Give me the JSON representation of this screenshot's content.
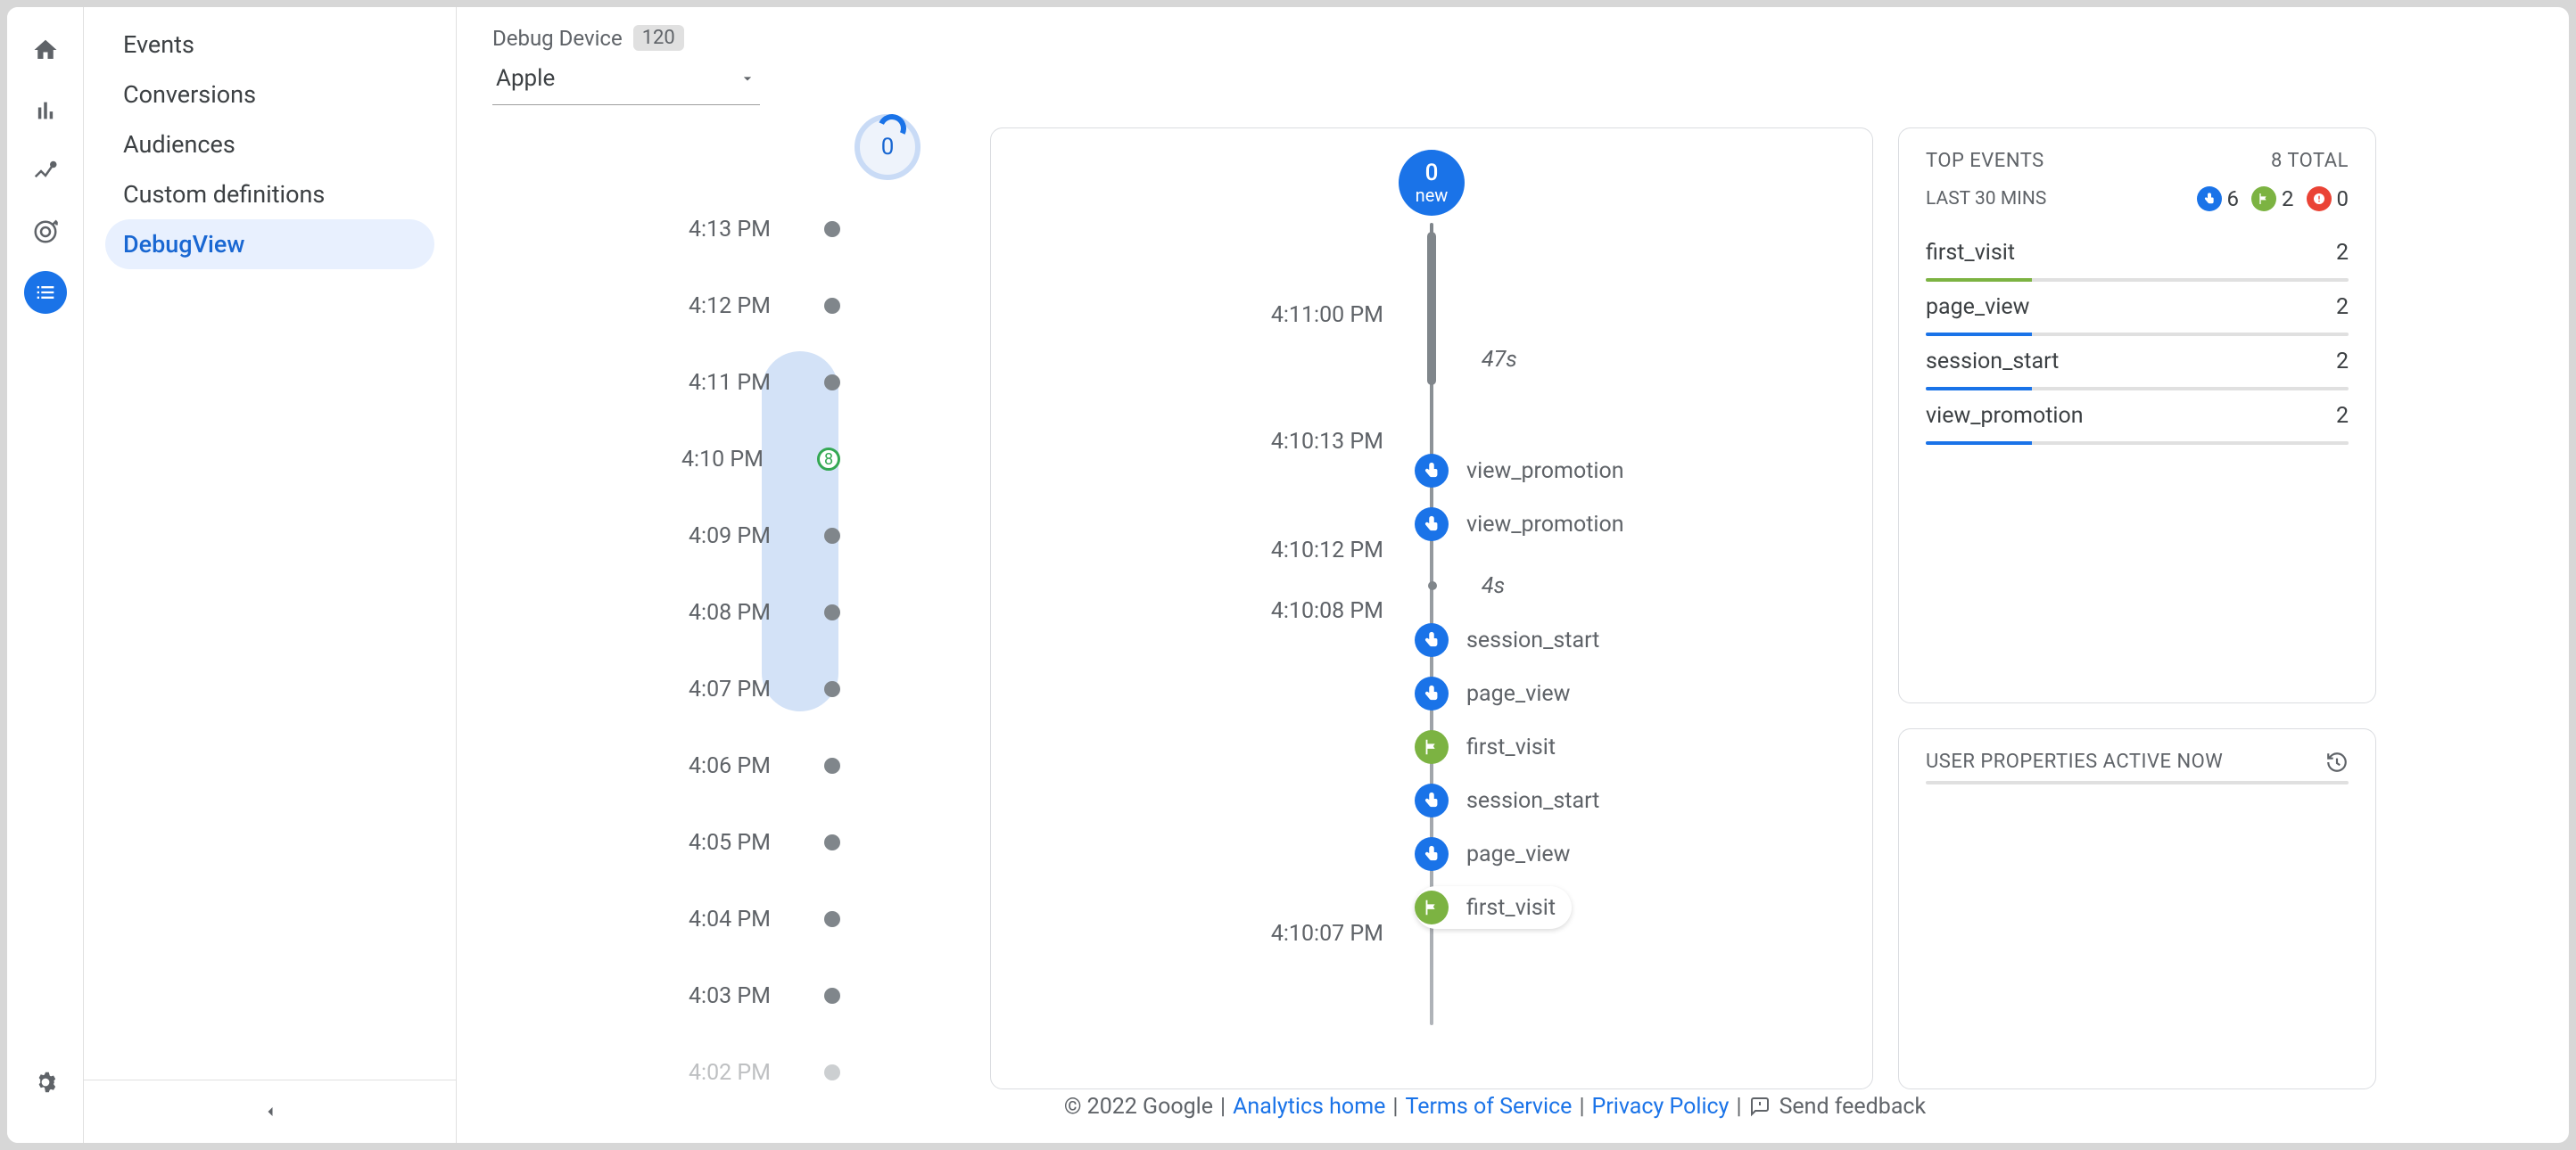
{
  "sidenav": {
    "items": [
      {
        "label": "Events"
      },
      {
        "label": "Conversions"
      },
      {
        "label": "Audiences"
      },
      {
        "label": "Custom definitions"
      },
      {
        "label": "DebugView"
      }
    ]
  },
  "header": {
    "debug_label": "Debug Device",
    "device_count": "120",
    "selected_device": "Apple"
  },
  "minute_timeline": {
    "zero": "0",
    "active_count": "8",
    "rows": [
      {
        "t": "4:13 PM"
      },
      {
        "t": "4:12 PM"
      },
      {
        "t": "4:11 PM"
      },
      {
        "t": "4:10 PM",
        "active": true
      },
      {
        "t": "4:09 PM"
      },
      {
        "t": "4:08 PM"
      },
      {
        "t": "4:07 PM"
      },
      {
        "t": "4:06 PM"
      },
      {
        "t": "4:05 PM"
      },
      {
        "t": "4:04 PM"
      },
      {
        "t": "4:03 PM"
      },
      {
        "t": "4:02 PM"
      }
    ]
  },
  "stream": {
    "new_count": "0",
    "new_label": "new",
    "timestamps": {
      "t1": "4:11:00 PM",
      "gap1": "47s",
      "t2": "4:10:13 PM",
      "t3": "4:10:12 PM",
      "gap2": "4s",
      "t4": "4:10:08 PM",
      "t5": "4:10:07 PM"
    },
    "events": [
      {
        "name": "view_promotion",
        "kind": "blue"
      },
      {
        "name": "view_promotion",
        "kind": "blue"
      },
      {
        "name": "session_start",
        "kind": "blue"
      },
      {
        "name": "page_view",
        "kind": "blue"
      },
      {
        "name": "first_visit",
        "kind": "green"
      },
      {
        "name": "session_start",
        "kind": "blue"
      },
      {
        "name": "page_view",
        "kind": "blue"
      },
      {
        "name": "first_visit",
        "kind": "green",
        "highlighted": true
      }
    ]
  },
  "top_events": {
    "title": "TOP EVENTS",
    "total_label": "8 TOTAL",
    "sub": "LAST 30 MINS",
    "counts": {
      "blue": "6",
      "green": "2",
      "red": "0"
    },
    "rows": [
      {
        "name": "first_visit",
        "count": "2",
        "fill": 25,
        "color": "green"
      },
      {
        "name": "page_view",
        "count": "2",
        "fill": 25,
        "color": "blue"
      },
      {
        "name": "session_start",
        "count": "2",
        "fill": 25,
        "color": "blue"
      },
      {
        "name": "view_promotion",
        "count": "2",
        "fill": 25,
        "color": "blue"
      }
    ]
  },
  "user_props": {
    "title": "USER PROPERTIES ACTIVE NOW"
  },
  "footer": {
    "copyright": "© 2022 Google",
    "link1": "Analytics home",
    "link2": "Terms of Service",
    "link3": "Privacy Policy",
    "feedback": "Send feedback"
  }
}
